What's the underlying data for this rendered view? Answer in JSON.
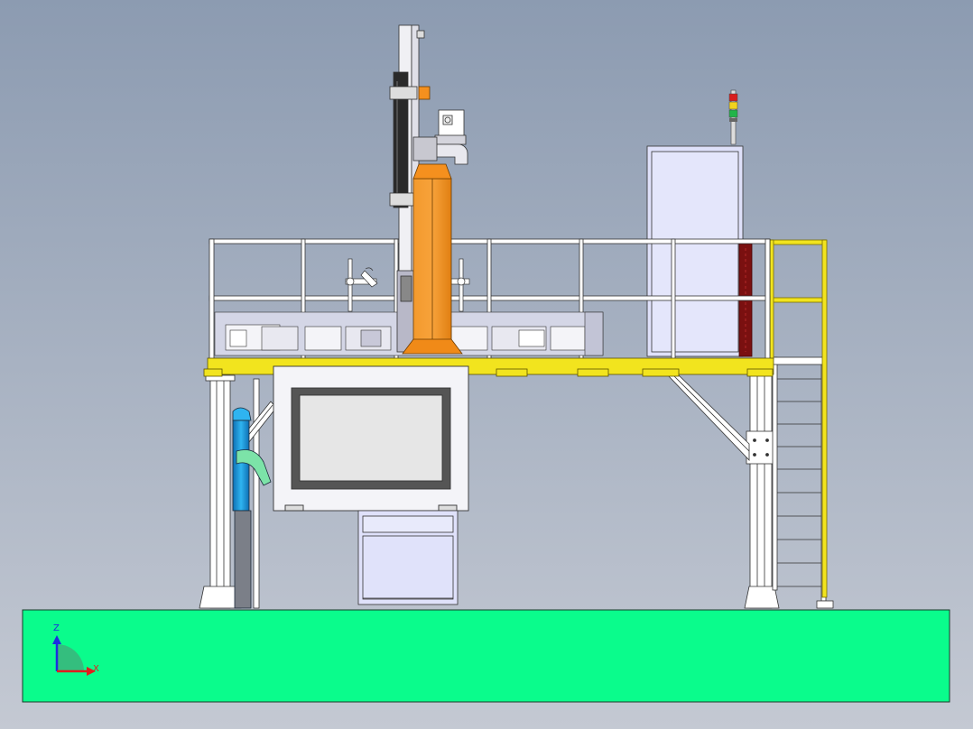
{
  "axis_triad": {
    "z_label": "Z",
    "x_label": "X"
  },
  "colors": {
    "background_top": "#8b9bb0",
    "background_bottom": "#c3c8d2",
    "ground": "#0afc8c",
    "platform_beam": "#f2e41e",
    "orange_column": "#f5901e",
    "light_frame": "#ffffff",
    "panel_blue": "#dfe1fa",
    "screen": "#e6e6e6",
    "operator_blue": "#1ea0e0",
    "operator_arm": "#7ce3a8",
    "axis_z": "#1e2de0",
    "axis_x": "#e01e1e"
  },
  "signal_tower": [
    "red",
    "yellow",
    "green"
  ]
}
